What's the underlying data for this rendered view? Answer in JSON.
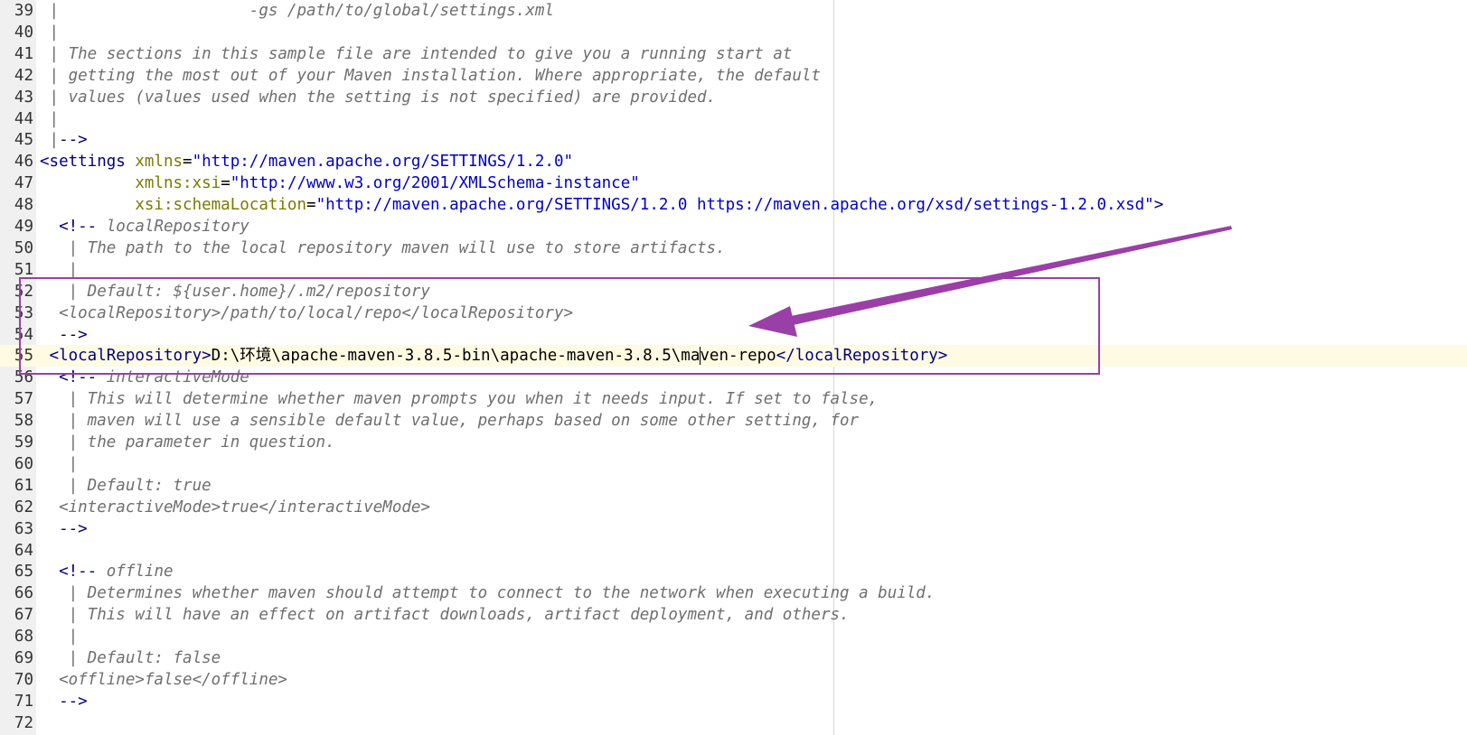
{
  "editor": {
    "current_line": "55",
    "lines": [
      {
        "n": "39",
        "parts": [
          {
            "k": "c",
            "t": " |                    -gs /path/to/global/settings.xml"
          }
        ]
      },
      {
        "n": "40",
        "parts": [
          {
            "k": "c",
            "t": " |"
          }
        ]
      },
      {
        "n": "41",
        "parts": [
          {
            "k": "c",
            "t": " | The sections in this sample file are intended to give you a running start at"
          }
        ]
      },
      {
        "n": "42",
        "parts": [
          {
            "k": "c",
            "t": " | getting the most out of your Maven installation. Where appropriate, the default"
          }
        ]
      },
      {
        "n": "43",
        "parts": [
          {
            "k": "c",
            "t": " | values (values used when the setting is not specified) are provided."
          }
        ]
      },
      {
        "n": "44",
        "parts": [
          {
            "k": "c",
            "t": " |"
          }
        ]
      },
      {
        "n": "45",
        "parts": [
          {
            "k": "c",
            "t": " |"
          },
          {
            "k": "t",
            "t": "-->"
          }
        ]
      },
      {
        "n": "46",
        "parts": [
          {
            "k": "t",
            "t": "<settings "
          },
          {
            "k": "a",
            "t": "xmlns"
          },
          {
            "k": "txt",
            "t": "="
          },
          {
            "k": "s",
            "t": "\"http://maven.apache.org/SETTINGS/1.2.0\""
          }
        ]
      },
      {
        "n": "47",
        "parts": [
          {
            "k": "txt",
            "t": "          "
          },
          {
            "k": "a",
            "t": "xmlns:xsi"
          },
          {
            "k": "txt",
            "t": "="
          },
          {
            "k": "s",
            "t": "\"http://www.w3.org/2001/XMLSchema-instance\""
          }
        ]
      },
      {
        "n": "48",
        "parts": [
          {
            "k": "txt",
            "t": "          "
          },
          {
            "k": "a",
            "t": "xsi:schemaLocation"
          },
          {
            "k": "txt",
            "t": "="
          },
          {
            "k": "s",
            "t": "\"http://maven.apache.org/SETTINGS/1.2.0 https://maven.apache.org/xsd/settings-1.2.0.xsd\""
          },
          {
            "k": "t",
            "t": ">"
          }
        ]
      },
      {
        "n": "49",
        "parts": [
          {
            "k": "t",
            "t": "  <!-- "
          },
          {
            "k": "c",
            "t": "localRepository"
          }
        ]
      },
      {
        "n": "50",
        "parts": [
          {
            "k": "c",
            "t": "   | The path to the local repository maven will use to store artifacts."
          }
        ]
      },
      {
        "n": "51",
        "parts": [
          {
            "k": "c",
            "t": "   |"
          }
        ]
      },
      {
        "n": "52",
        "parts": [
          {
            "k": "c",
            "t": "   | Default: ${user.home}/.m2/repository"
          }
        ]
      },
      {
        "n": "53",
        "parts": [
          {
            "k": "c",
            "t": "  <localRepository>/path/to/local/repo</localRepository>"
          }
        ]
      },
      {
        "n": "54",
        "parts": [
          {
            "k": "t",
            "t": "  -->"
          }
        ]
      },
      {
        "n": "55",
        "parts": [
          {
            "k": "t",
            "t": " <localRepository>"
          },
          {
            "k": "txt",
            "t": "D:\\环境\\apache-maven-3.8.5-bin\\apache-maven-3.8.5\\ma"
          },
          {
            "k": "caret",
            "t": ""
          },
          {
            "k": "txt",
            "t": "ven-repo"
          },
          {
            "k": "t",
            "t": "</localRepository>"
          }
        ]
      },
      {
        "n": "56",
        "parts": [
          {
            "k": "t",
            "t": "  <!-- "
          },
          {
            "k": "c",
            "t": "interactiveMode"
          }
        ]
      },
      {
        "n": "57",
        "parts": [
          {
            "k": "c",
            "t": "   | This will determine whether maven prompts you when it needs input. If set to false,"
          }
        ]
      },
      {
        "n": "58",
        "parts": [
          {
            "k": "c",
            "t": "   | maven will use a sensible default value, perhaps based on some other setting, for"
          }
        ]
      },
      {
        "n": "59",
        "parts": [
          {
            "k": "c",
            "t": "   | the parameter in question."
          }
        ]
      },
      {
        "n": "60",
        "parts": [
          {
            "k": "c",
            "t": "   |"
          }
        ]
      },
      {
        "n": "61",
        "parts": [
          {
            "k": "c",
            "t": "   | Default: true"
          }
        ]
      },
      {
        "n": "62",
        "parts": [
          {
            "k": "c",
            "t": "  <interactiveMode>true</interactiveMode>"
          }
        ]
      },
      {
        "n": "63",
        "parts": [
          {
            "k": "t",
            "t": "  -->"
          }
        ]
      },
      {
        "n": "64",
        "parts": []
      },
      {
        "n": "65",
        "parts": [
          {
            "k": "t",
            "t": "  <!-- "
          },
          {
            "k": "c",
            "t": "offline"
          }
        ]
      },
      {
        "n": "66",
        "parts": [
          {
            "k": "c",
            "t": "   | Determines whether maven should attempt to connect to the network when executing a build."
          }
        ]
      },
      {
        "n": "67",
        "parts": [
          {
            "k": "c",
            "t": "   | This will have an effect on artifact downloads, artifact deployment, and others."
          }
        ]
      },
      {
        "n": "68",
        "parts": [
          {
            "k": "c",
            "t": "   |"
          }
        ]
      },
      {
        "n": "69",
        "parts": [
          {
            "k": "c",
            "t": "   | Default: false"
          }
        ]
      },
      {
        "n": "70",
        "parts": [
          {
            "k": "c",
            "t": "  <offline>false</offline>"
          }
        ]
      },
      {
        "n": "71",
        "parts": [
          {
            "k": "t",
            "t": "  -->"
          }
        ]
      },
      {
        "n": "72",
        "parts": []
      }
    ]
  },
  "annotation": {
    "color": "#9b3fa8"
  }
}
